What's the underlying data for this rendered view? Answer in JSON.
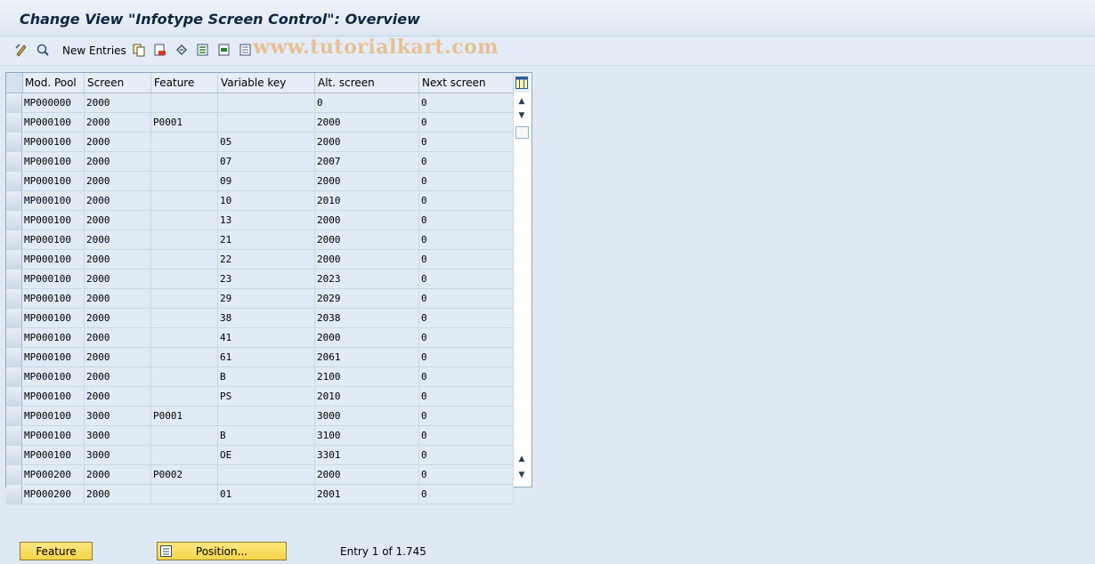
{
  "window": {
    "title": "Change View \"Infotype Screen Control\": Overview"
  },
  "toolbar": {
    "new_entries_label": "New Entries",
    "icons": [
      "change-display-icon",
      "find-icon",
      "copy-as-icon",
      "delete-icon",
      "undo-change-icon",
      "select-all-icon",
      "select-block-icon",
      "deselect-all-icon"
    ]
  },
  "watermark": "www.tutorialkart.com",
  "table": {
    "columns": [
      "Mod. Pool",
      "Screen",
      "Feature",
      "Variable key",
      "Alt. screen",
      "Next screen"
    ],
    "rows": [
      [
        "MP000000",
        "2000",
        "",
        "",
        "0",
        "0"
      ],
      [
        "MP000100",
        "2000",
        "P0001",
        "",
        "2000",
        "0"
      ],
      [
        "MP000100",
        "2000",
        "",
        "05",
        "2000",
        "0"
      ],
      [
        "MP000100",
        "2000",
        "",
        "07",
        "2007",
        "0"
      ],
      [
        "MP000100",
        "2000",
        "",
        "09",
        "2000",
        "0"
      ],
      [
        "MP000100",
        "2000",
        "",
        "10",
        "2010",
        "0"
      ],
      [
        "MP000100",
        "2000",
        "",
        "13",
        "2000",
        "0"
      ],
      [
        "MP000100",
        "2000",
        "",
        "21",
        "2000",
        "0"
      ],
      [
        "MP000100",
        "2000",
        "",
        "22",
        "2000",
        "0"
      ],
      [
        "MP000100",
        "2000",
        "",
        "23",
        "2023",
        "0"
      ],
      [
        "MP000100",
        "2000",
        "",
        "29",
        "2029",
        "0"
      ],
      [
        "MP000100",
        "2000",
        "",
        "38",
        "2038",
        "0"
      ],
      [
        "MP000100",
        "2000",
        "",
        "41",
        "2000",
        "0"
      ],
      [
        "MP000100",
        "2000",
        "",
        "61",
        "2061",
        "0"
      ],
      [
        "MP000100",
        "2000",
        "",
        "B",
        "2100",
        "0"
      ],
      [
        "MP000100",
        "2000",
        "",
        "PS",
        "2010",
        "0"
      ],
      [
        "MP000100",
        "3000",
        "P0001",
        "",
        "3000",
        "0"
      ],
      [
        "MP000100",
        "3000",
        "",
        "B",
        "3100",
        "0"
      ],
      [
        "MP000100",
        "3000",
        "",
        "OE",
        "3301",
        "0"
      ],
      [
        "MP000200",
        "2000",
        "P0002",
        "",
        "2000",
        "0"
      ],
      [
        "MP000200",
        "2000",
        "",
        "01",
        "2001",
        "0"
      ]
    ]
  },
  "footer": {
    "feature_button": "Feature",
    "position_button": "Position...",
    "entry_info": "Entry 1 of 1.745"
  },
  "colors": {
    "background": "#dfe9f4",
    "title_text": "#10253f",
    "button_yellow": "#f5d44b",
    "watermark": "#e8b270"
  }
}
